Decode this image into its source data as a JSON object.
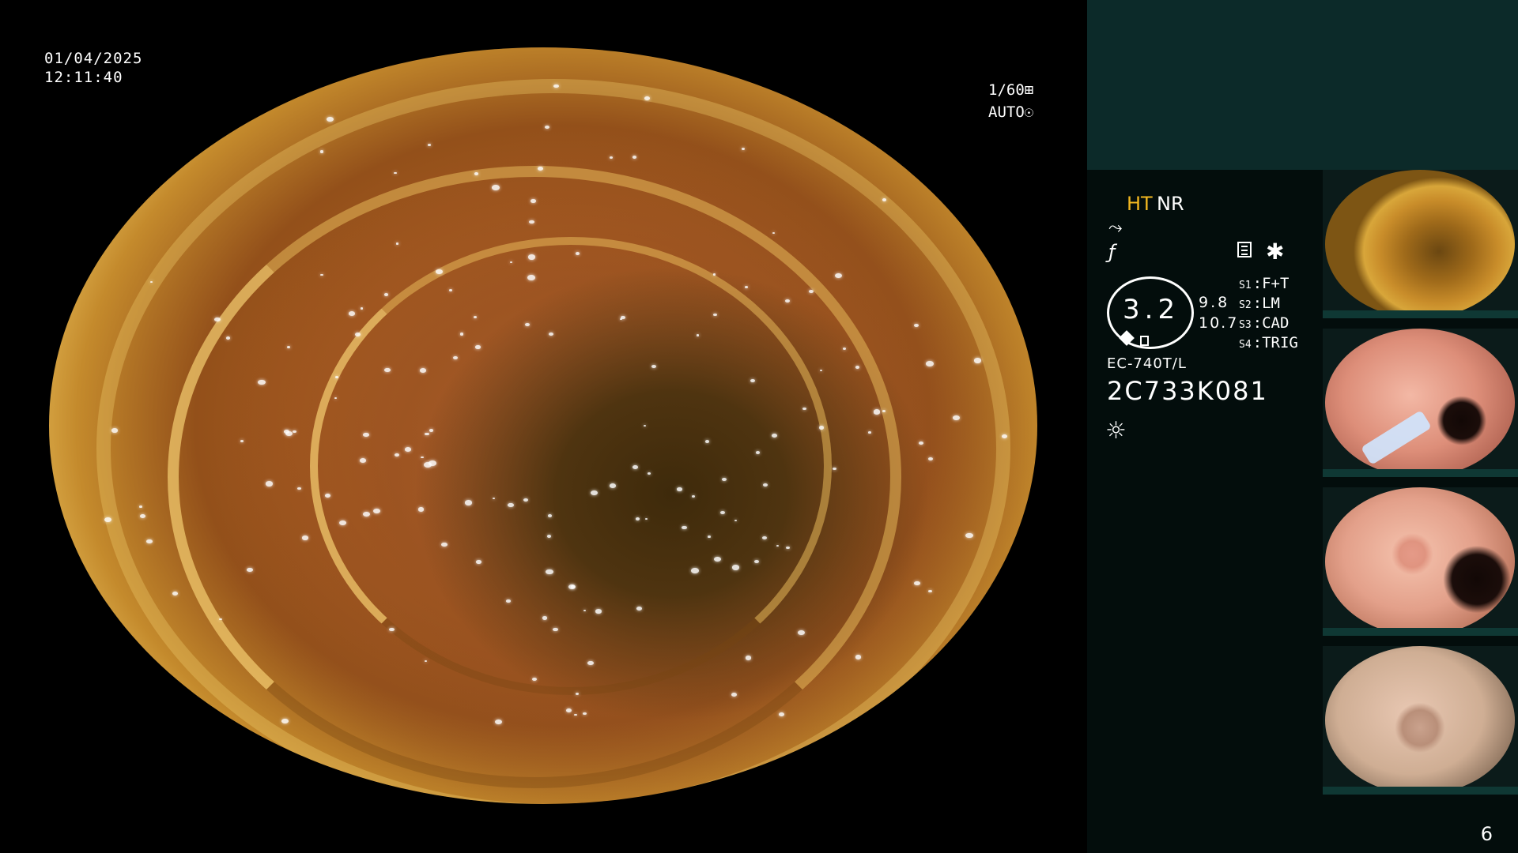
{
  "main_view": {
    "date": "01/04/2025",
    "time": "12:11:40",
    "shutter": "1/60",
    "exposure": "AUTO",
    "shutter_icon": "aperture-icon",
    "exposure_icon": "iris-icon"
  },
  "panel": {
    "mode_ht": "HT",
    "mode_nr": "NR",
    "enhance_icon": "⤳",
    "freeze_icon": "ƒ",
    "memo_icon": "memo-icon",
    "star_icon": "✱",
    "scale_value": "3.2",
    "ratio_top": "9.8",
    "ratio_bottom": "10.7",
    "switches": [
      {
        "key": "S1",
        "value": "F+T"
      },
      {
        "key": "S2",
        "value": "LM"
      },
      {
        "key": "S3",
        "value": "CAD"
      },
      {
        "key": "S4",
        "value": "TRIG"
      }
    ],
    "scope_model": "EC-740T/L",
    "scope_serial": "2C733K081",
    "light_icon": "☼"
  },
  "thumbnails": [
    {
      "name": "capture-1"
    },
    {
      "name": "capture-2"
    },
    {
      "name": "capture-3"
    },
    {
      "name": "capture-4"
    }
  ],
  "page_number": "6",
  "colors": {
    "panel_top": "#0c2a29",
    "panel_bg": "#030d0c",
    "ht_accent": "#f2b720"
  }
}
